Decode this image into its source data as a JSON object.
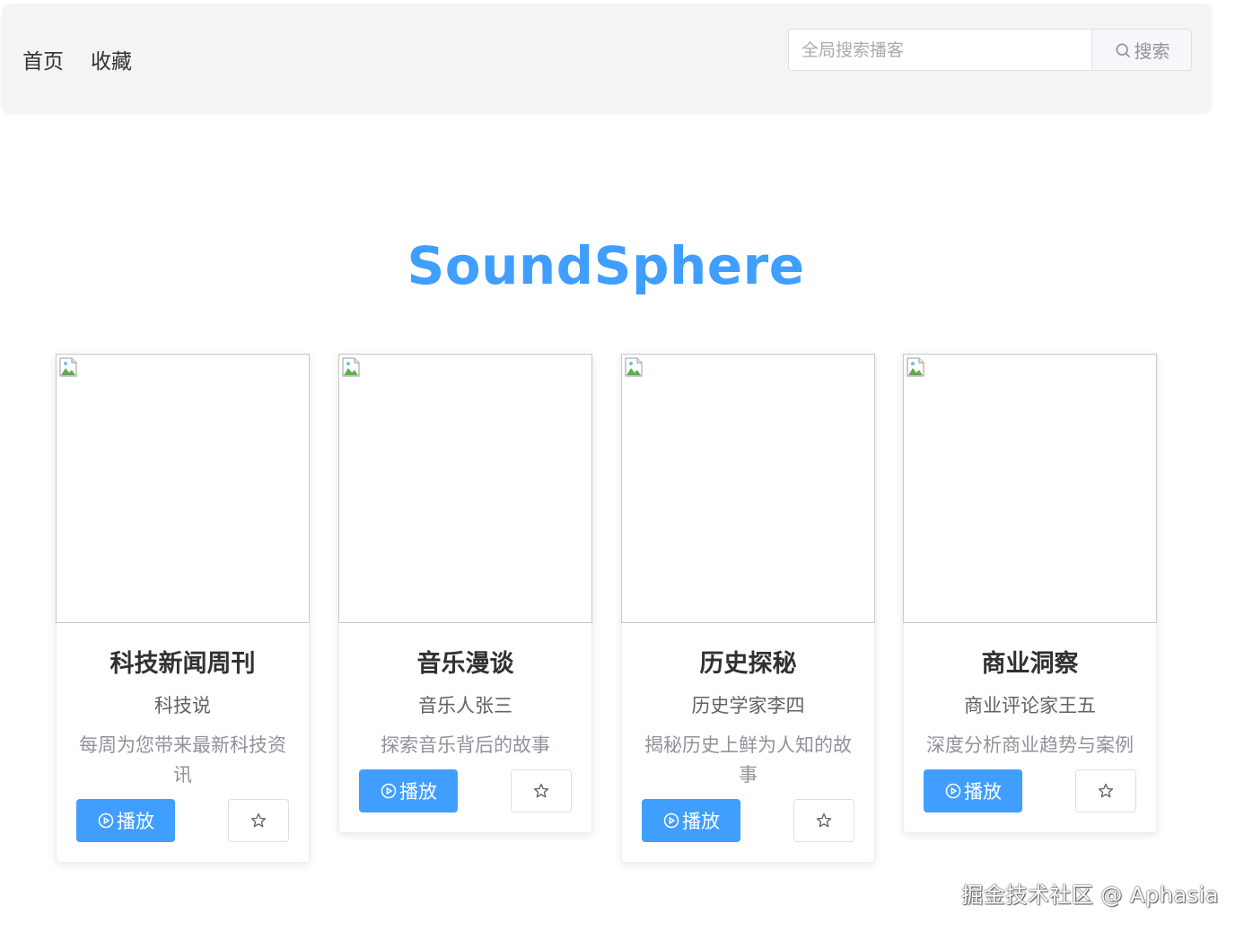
{
  "nav": {
    "items": [
      "首页",
      "收藏"
    ]
  },
  "search": {
    "placeholder": "全局搜索播客",
    "button_label": "搜索",
    "button_icon": "search-icon"
  },
  "brand": {
    "title": "SoundSphere",
    "color": "#409eff"
  },
  "cards": [
    {
      "title": "科技新闻周刊",
      "author": "科技说",
      "description": "每周为您带来最新科技资讯",
      "play_label": "播放"
    },
    {
      "title": "音乐漫谈",
      "author": "音乐人张三",
      "description": "探索音乐背后的故事",
      "play_label": "播放"
    },
    {
      "title": "历史探秘",
      "author": "历史学家李四",
      "description": "揭秘历史上鲜为人知的故事",
      "play_label": "播放"
    },
    {
      "title": "商业洞察",
      "author": "商业评论家王五",
      "description": "深度分析商业趋势与案例",
      "play_label": "播放"
    }
  ],
  "icons": {
    "play": "play-circle-icon",
    "favorite": "star-icon",
    "cover": "broken-image-icon"
  },
  "watermark": "掘金技术社区 @ Aphasia"
}
